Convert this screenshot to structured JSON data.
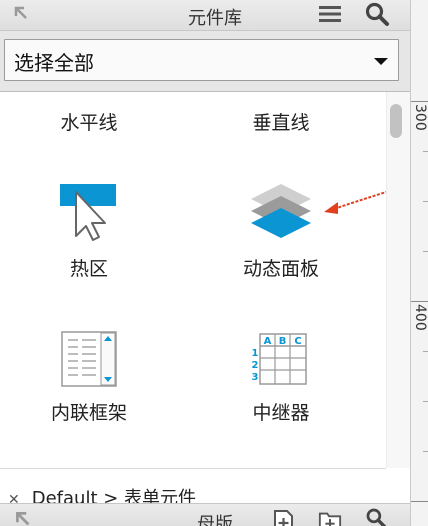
{
  "library": {
    "title": "元件库",
    "collapse_icon": "collapse-arrow-icon",
    "menu_icon": "hamburger-menu-icon",
    "search_icon": "search-icon"
  },
  "filter": {
    "selected": "选择全部"
  },
  "widgets": [
    {
      "label": "水平线",
      "icon": ""
    },
    {
      "label": "垂直线",
      "icon": ""
    },
    {
      "label": "热区",
      "icon": "hotspot-icon"
    },
    {
      "label": "动态面板",
      "icon": "dynamic-panel-icon"
    },
    {
      "label": "内联框架",
      "icon": "inline-frame-icon"
    },
    {
      "label": "中继器",
      "icon": "repeater-icon"
    }
  ],
  "repeater_icon": {
    "columns": [
      "A",
      "B",
      "C"
    ],
    "rows": [
      "1",
      "2",
      "3"
    ]
  },
  "breadcrumb": "Default > 表单元件",
  "masters": {
    "title": "母版"
  },
  "ruler": {
    "labels": [
      "300",
      "400"
    ]
  },
  "colors": {
    "accent": "#0b95d3",
    "annotation_arrow": "#e04020"
  }
}
